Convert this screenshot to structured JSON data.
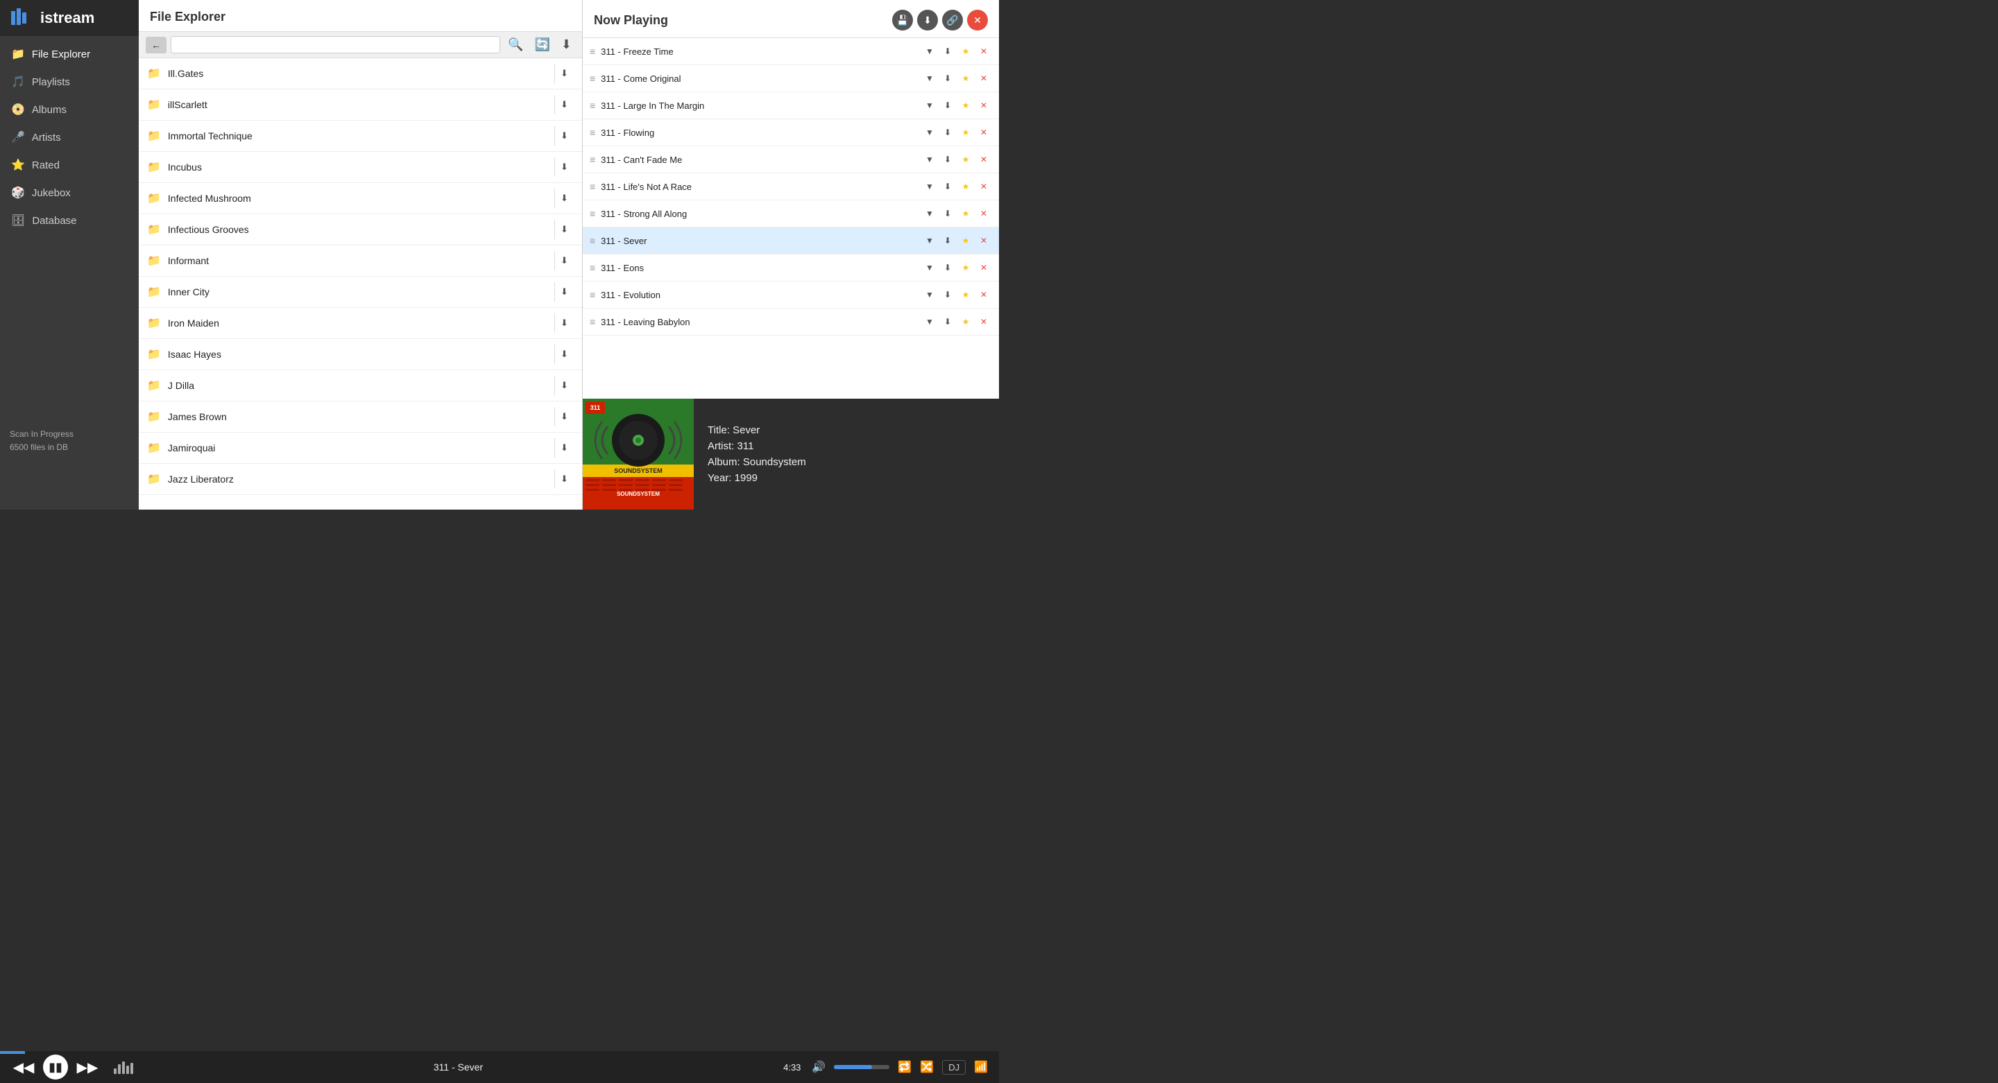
{
  "app": {
    "name": "istream",
    "logo_letters": "istream"
  },
  "sidebar": {
    "items": [
      {
        "id": "file-explorer",
        "label": "File Explorer",
        "icon": "📁",
        "active": true
      },
      {
        "id": "playlists",
        "label": "Playlists",
        "icon": "🎵",
        "active": false
      },
      {
        "id": "albums",
        "label": "Albums",
        "icon": "📀",
        "active": false
      },
      {
        "id": "artists",
        "label": "Artists",
        "icon": "🎤",
        "active": false
      },
      {
        "id": "rated",
        "label": "Rated",
        "icon": "⭐",
        "active": false,
        "star": true
      },
      {
        "id": "jukebox",
        "label": "Jukebox",
        "icon": "🎲",
        "active": false
      },
      {
        "id": "database",
        "label": "Database",
        "icon": "🗄",
        "active": false
      }
    ],
    "scan_status": "Scan In Progress",
    "scan_count": "6500 files in DB"
  },
  "file_explorer": {
    "title": "File Explorer",
    "search_placeholder": "",
    "folders": [
      "Ill.Gates",
      "illScarlett",
      "Immortal Technique",
      "Incubus",
      "Infected Mushroom",
      "Infectious Grooves",
      "Informant",
      "Inner City",
      "Iron Maiden",
      "Isaac Hayes",
      "J Dilla",
      "James Brown",
      "Jamiroquai",
      "Jazz Liberatorz"
    ]
  },
  "now_playing": {
    "title": "Now Playing",
    "actions": {
      "save": "💾",
      "download": "⬇",
      "share": "🔗",
      "close": "✕"
    },
    "tracks": [
      {
        "name": "311 - Freeze Time",
        "active": false
      },
      {
        "name": "311 - Come Original",
        "active": false
      },
      {
        "name": "311 - Large In The Margin",
        "active": false
      },
      {
        "name": "311 - Flowing",
        "active": false
      },
      {
        "name": "311 - Can't Fade Me",
        "active": false
      },
      {
        "name": "311 - Life's Not A Race",
        "active": false
      },
      {
        "name": "311 - Strong All Along",
        "active": false
      },
      {
        "name": "311 - Sever",
        "active": true
      },
      {
        "name": "311 - Eons",
        "active": false
      },
      {
        "name": "311 - Evolution",
        "active": false
      },
      {
        "name": "311 - Leaving Babylon",
        "active": false
      }
    ],
    "current_track": {
      "title": "Title: Sever",
      "artist": "Artist: 311",
      "album": "Album: Soundsystem",
      "year": "Year: 1999"
    }
  },
  "player": {
    "track_name": "311 - Sever",
    "time": "4:33",
    "progress_pct": 2.5
  }
}
